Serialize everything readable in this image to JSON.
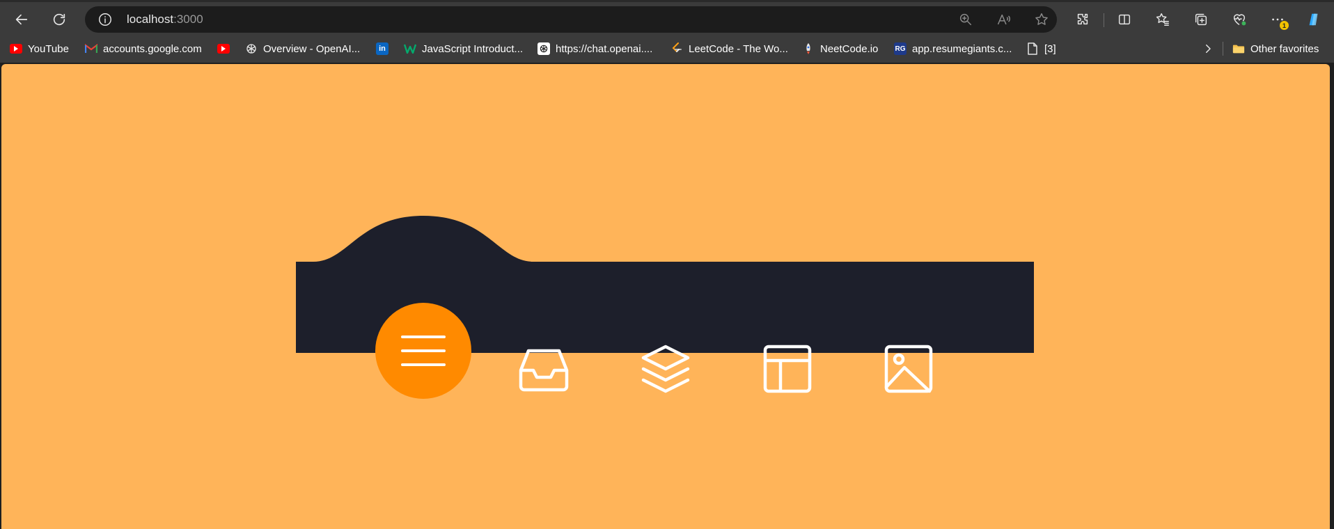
{
  "address_bar": {
    "host": "localhost",
    "port": ":3000"
  },
  "bookmarks": [
    {
      "label": "YouTube",
      "icon": "youtube-icon"
    },
    {
      "label": "accounts.google.com",
      "icon": "gmail-icon"
    },
    {
      "label": "",
      "icon": "youtube-icon"
    },
    {
      "label": "Overview - OpenAI...",
      "icon": "openai-icon"
    },
    {
      "label": "",
      "icon": "linkedin-icon"
    },
    {
      "label": "JavaScript Introduct...",
      "icon": "w-icon"
    },
    {
      "label": "https://chat.openai....",
      "icon": "openai-icon"
    },
    {
      "label": "LeetCode - The Wo...",
      "icon": "leetcode-icon"
    },
    {
      "label": "NeetCode.io",
      "icon": "rocket-icon"
    },
    {
      "label": "app.resumegiants.c...",
      "icon": "rg-icon"
    },
    {
      "label": "[3]",
      "icon": "file-icon"
    }
  ],
  "other_favorites": "Other favorites",
  "notification_badge": "1",
  "rg_badge_text": "RG",
  "linkedin_badge_text": "in",
  "colors": {
    "page_background": "#ffb459",
    "navbar": "#1d1f2b",
    "menu_button": "#ff8a00",
    "icon_stroke": "#ffffff"
  },
  "nav_items": [
    {
      "name": "menu",
      "icon": "hamburger-icon",
      "active": true
    },
    {
      "name": "inbox",
      "icon": "inbox-icon",
      "active": false
    },
    {
      "name": "layers",
      "icon": "layers-icon",
      "active": false
    },
    {
      "name": "layout",
      "icon": "layout-icon",
      "active": false
    },
    {
      "name": "image",
      "icon": "image-icon",
      "active": false
    }
  ]
}
